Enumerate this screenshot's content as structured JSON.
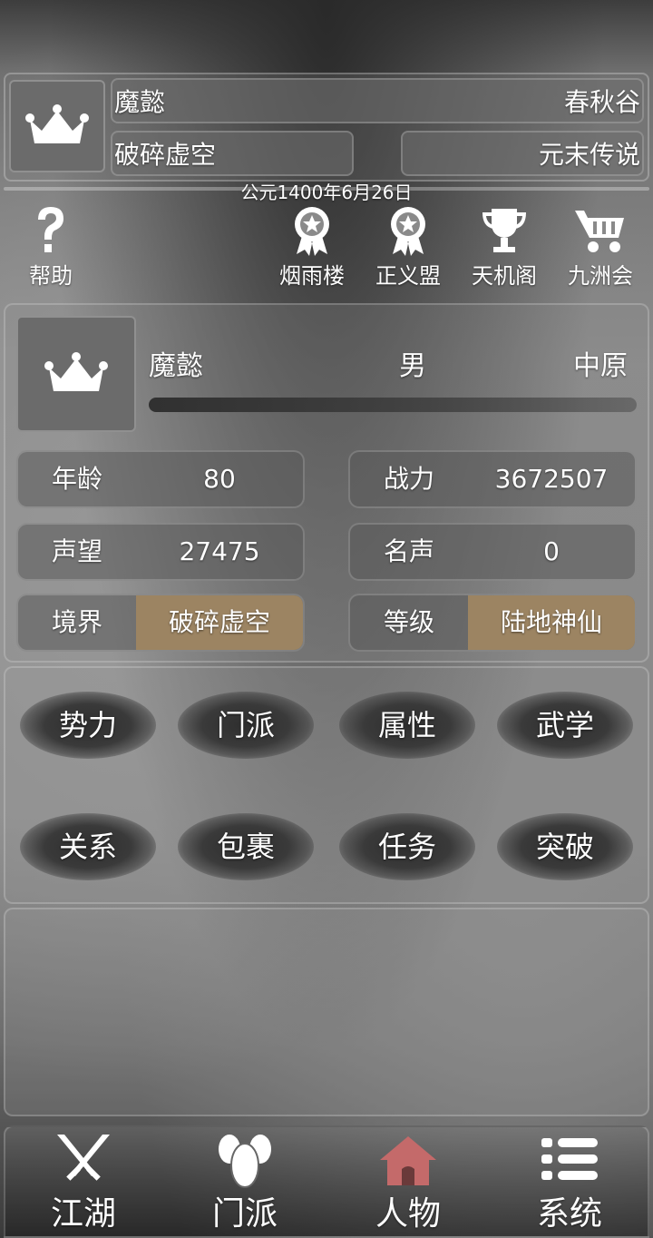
{
  "header": {
    "player_name": "魔懿",
    "location": "春秋谷",
    "realm": "破碎虚空",
    "era": "元末传说",
    "date": "公元1400年6月26日"
  },
  "top_nav": [
    {
      "label": "帮助",
      "icon": "question-icon"
    },
    {
      "label": "烟雨楼",
      "icon": "ribbon-badge-icon"
    },
    {
      "label": "正义盟",
      "icon": "ribbon-badge-icon"
    },
    {
      "label": "天机阁",
      "icon": "trophy-icon"
    },
    {
      "label": "九洲会",
      "icon": "cart-icon"
    }
  ],
  "profile": {
    "name": "魔懿",
    "gender": "男",
    "region": "中原",
    "stats": {
      "age_label": "年龄",
      "age": "80",
      "power_label": "战力",
      "power": "3672507",
      "prestige_label": "声望",
      "prestige": "27475",
      "fame_label": "名声",
      "fame": "0",
      "realm_label": "境界",
      "realm": "破碎虚空",
      "level_label": "等级",
      "level": "陆地神仙"
    }
  },
  "actions": [
    "势力",
    "门派",
    "属性",
    "武学",
    "关系",
    "包裹",
    "任务",
    "突破"
  ],
  "bottom_nav": [
    {
      "label": "江湖",
      "icon": "crossed-swords-icon"
    },
    {
      "label": "门派",
      "icon": "group-icon"
    },
    {
      "label": "人物",
      "icon": "house-icon",
      "active": true
    },
    {
      "label": "系统",
      "icon": "list-icon"
    }
  ],
  "colors": {
    "highlight": "#9c8462",
    "active_nav": "#c46a6a"
  }
}
